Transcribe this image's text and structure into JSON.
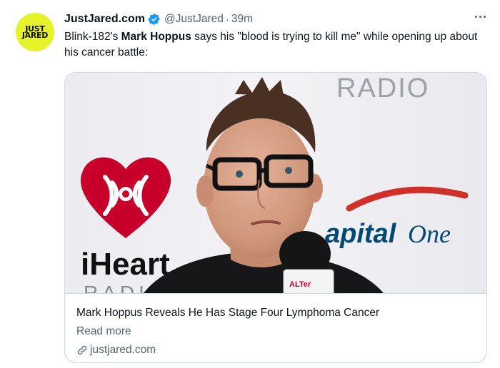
{
  "tweet": {
    "avatar": {
      "line1": "JUST",
      "line2": "JARED",
      "color": "#e6f22a"
    },
    "author_name": "JustJared.com",
    "handle": "@JustJared",
    "separator": "·",
    "time": "39m",
    "verified_icon": "verified-badge-icon",
    "more_icon": "more-options-icon",
    "text_before": "Blink-182's ",
    "text_bold": "Mark Hoppus",
    "text_after": " says his \"blood is trying to kill me\" while opening up about his cancer battle:"
  },
  "card": {
    "image": {
      "backdrop_radio": "RADIO",
      "backdrop_iheart": "iHeart",
      "backdrop_capital": "apital",
      "backdrop_one": "One",
      "mic_flag": "ALTer"
    },
    "title": "Mark Hoppus Reveals He Has Stage Four Lymphoma Cancer",
    "read_more": "Read more",
    "domain": "justjared.com",
    "link_icon": "link-icon"
  },
  "colors": {
    "accent_blue": "#1d9bf0",
    "secondary_text": "#536471",
    "border": "#cfd9de",
    "iheart_red": "#c6002b",
    "capital_one_blue": "#004977",
    "capital_one_red": "#d03027"
  }
}
